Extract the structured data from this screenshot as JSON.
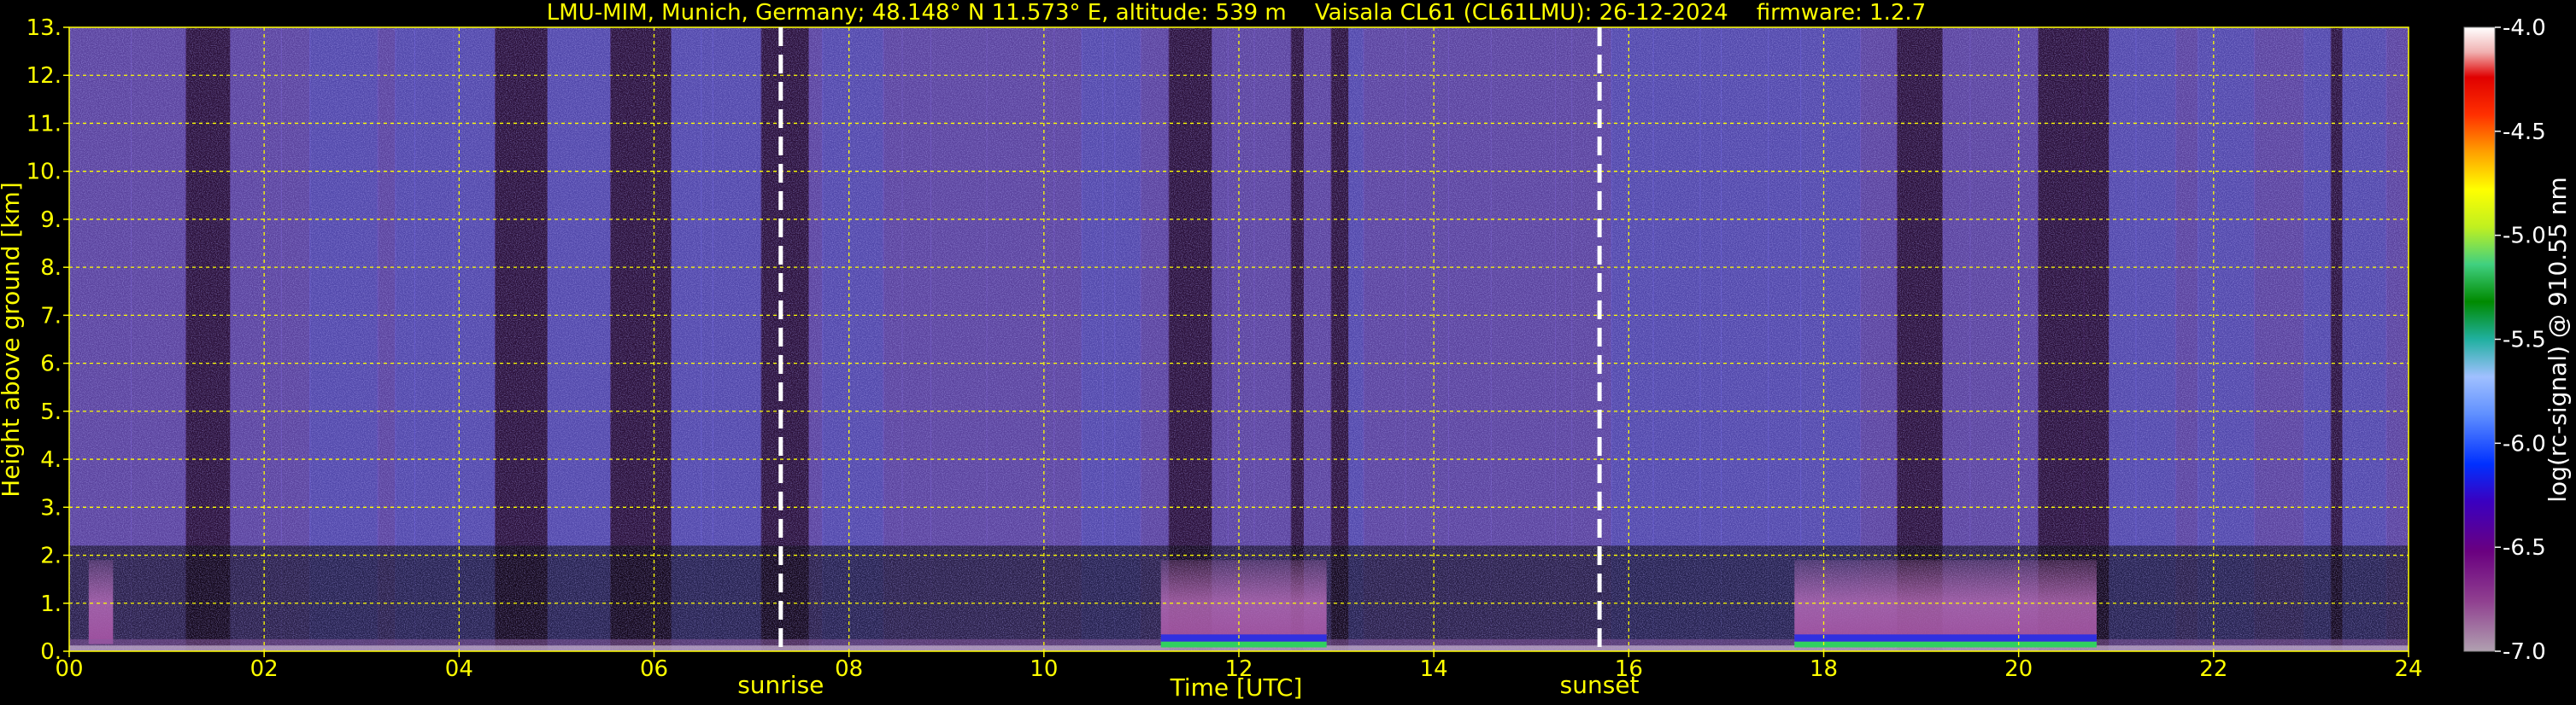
{
  "chart_data": {
    "type": "heatmap",
    "title": "LMU-MIM, Munich, Germany; 48.148° N 11.573° E, altitude: 539 m    Vaisala CL61 (CL61LMU): 26-12-2024    firmware: 1.2.7",
    "xlabel": "Time [UTC]",
    "ylabel": "Height above ground [km]",
    "xlim": [
      0,
      24
    ],
    "ylim": [
      0,
      13
    ],
    "x_ticks": [
      "00",
      "02",
      "04",
      "06",
      "08",
      "10",
      "12",
      "14",
      "16",
      "18",
      "20",
      "22",
      "24"
    ],
    "y_ticks": [
      "0.",
      "1.",
      "2.",
      "3.",
      "4.",
      "5.",
      "6.",
      "7.",
      "8.",
      "9.",
      "10.",
      "11.",
      "12.",
      "13."
    ],
    "grid": true,
    "colorbar": {
      "label": "log(rc-signal) @ 910.55 nm",
      "range": [
        -7.0,
        -4.0
      ],
      "ticks": [
        "-4.0",
        "-4.5",
        "-5.0",
        "-5.5",
        "-6.0",
        "-6.5",
        "-7.0"
      ]
    },
    "markers": [
      {
        "label": "sunrise",
        "x": 7.3
      },
      {
        "label": "sunset",
        "x": 15.7
      }
    ],
    "cloud_layers": [
      {
        "x_start": 11.2,
        "x_end": 12.9,
        "top_km": 1.9
      },
      {
        "x_start": 17.7,
        "x_end": 20.8,
        "top_km": 1.9
      },
      {
        "x_start": 0.2,
        "x_end": 0.45,
        "top_km": 1.9
      }
    ]
  },
  "colors": {
    "background": "#000000",
    "text_axes": "#ffff00",
    "text_colorbar": "#ffffff",
    "grid": "#ffff00",
    "marker_line": "#ffffff"
  }
}
